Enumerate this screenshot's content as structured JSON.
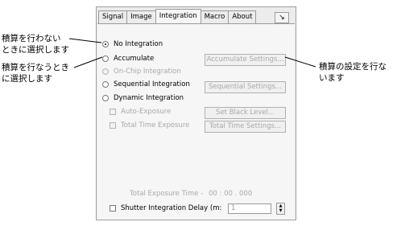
{
  "tabs": [
    "Signal",
    "Image",
    "Integration",
    "Macro",
    "About"
  ],
  "active_tab": "Integration",
  "corner_icon": "pin-icon",
  "radios": {
    "no_integration": "No Integration",
    "accumulate": "Accumulate",
    "on_chip": "On-Chip Integration",
    "sequential": "Sequential Integration",
    "dynamic": "Dynamic Integration"
  },
  "selected_radio": "No Integration",
  "checks": {
    "auto_exposure": "Auto-Exposure",
    "total_time_exposure": "Total Time Exposure",
    "shutter_delay": "Shutter Integration Delay (m:"
  },
  "buttons": {
    "accumulate_settings": "Accumulate Settings...",
    "sequential_settings": "Sequential Settings...",
    "set_black_level": "Set Black Level...",
    "total_time_settings": "Total Time Settings..."
  },
  "total_exposure": {
    "label": "Total Exposure Time -",
    "value": "00 : 00 . 000"
  },
  "shutter_delay_value": "1",
  "annotations": {
    "left_1_line1": "積算を行わない",
    "left_1_line2": "ときに選択します",
    "left_2_line1": "積算を行なうとき",
    "left_2_line2": "に選択します",
    "right_line1": "積算の設定を行な",
    "right_line2": "います"
  }
}
